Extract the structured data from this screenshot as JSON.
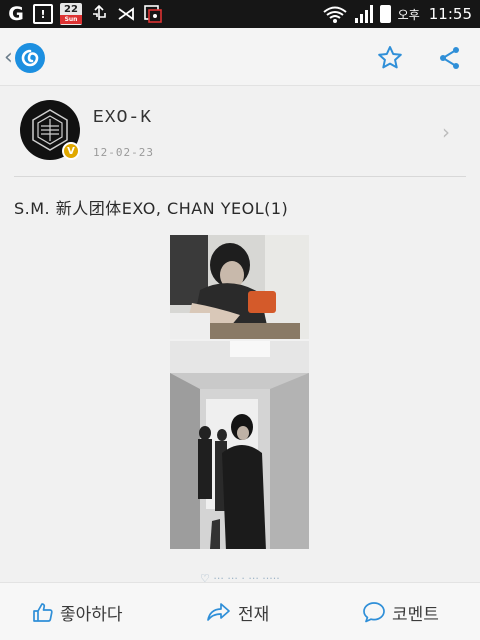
{
  "status_bar": {
    "calendar_day": "22",
    "calendar_weekday": "Sun",
    "ampm": "오후",
    "time": "11:55",
    "icons": [
      "g-icon",
      "notification-icon",
      "calendar-icon",
      "usb-icon",
      "bluetooth-icon",
      "gallery-icon",
      "wifi-icon",
      "signal-icon",
      "battery-icon"
    ]
  },
  "header": {
    "back_glyph": "‹",
    "app_icon": "app-logo-icon",
    "actions": [
      "star-icon",
      "share-icon"
    ]
  },
  "profile": {
    "name": "EXO-K",
    "date": "12-02-23",
    "badge": "V",
    "chevron": "›"
  },
  "post": {
    "title": "S.M. 新人团体EXO, CHAN YEOL(1)",
    "meta_fragment": "♡ ···  ··· ·  ···  ·····"
  },
  "bottom_bar": {
    "like_label": "좋아하다",
    "share_label": "전재",
    "comment_label": "코멘트",
    "accent_color": "#2f8fd8"
  }
}
